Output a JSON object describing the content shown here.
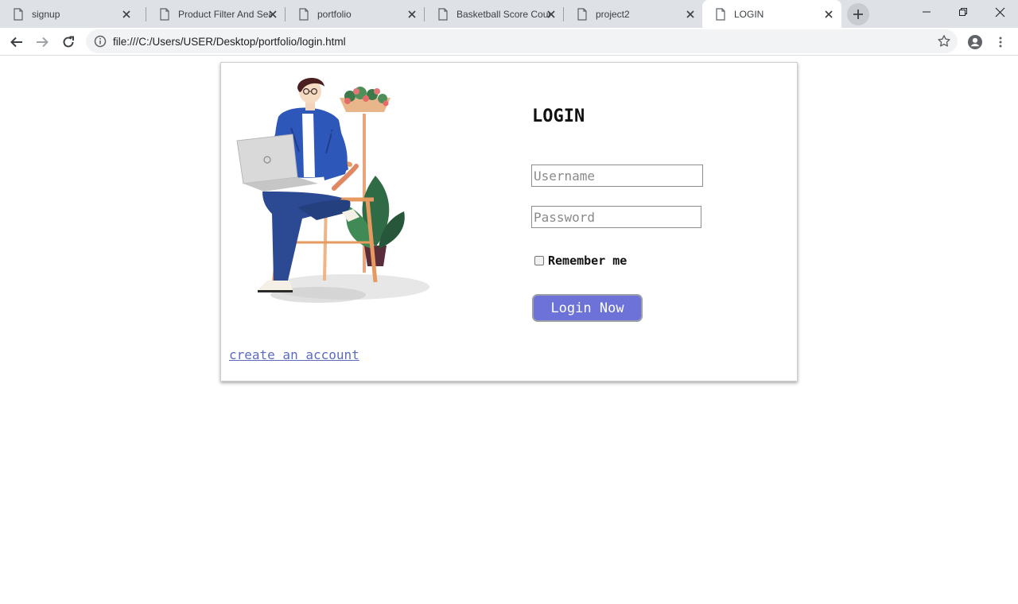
{
  "browser": {
    "tabs": [
      {
        "title": "signup",
        "active": false
      },
      {
        "title": "Product Filter And Search",
        "active": false
      },
      {
        "title": "portfolio",
        "active": false
      },
      {
        "title": "Basketball Score Counter",
        "active": false
      },
      {
        "title": "project2",
        "active": false
      },
      {
        "title": "LOGIN",
        "active": true
      }
    ],
    "url": "file:///C:/Users/USER/Desktop/portfolio/login.html"
  },
  "login": {
    "title": "LOGIN",
    "username_placeholder": "Username",
    "password_placeholder": "Password",
    "remember_label": "Remember me",
    "remember_checked": false,
    "submit_label": "Login Now",
    "create_account_label": "create an account"
  },
  "colors": {
    "button": "#6c72d8",
    "link": "#5c6bc0"
  }
}
